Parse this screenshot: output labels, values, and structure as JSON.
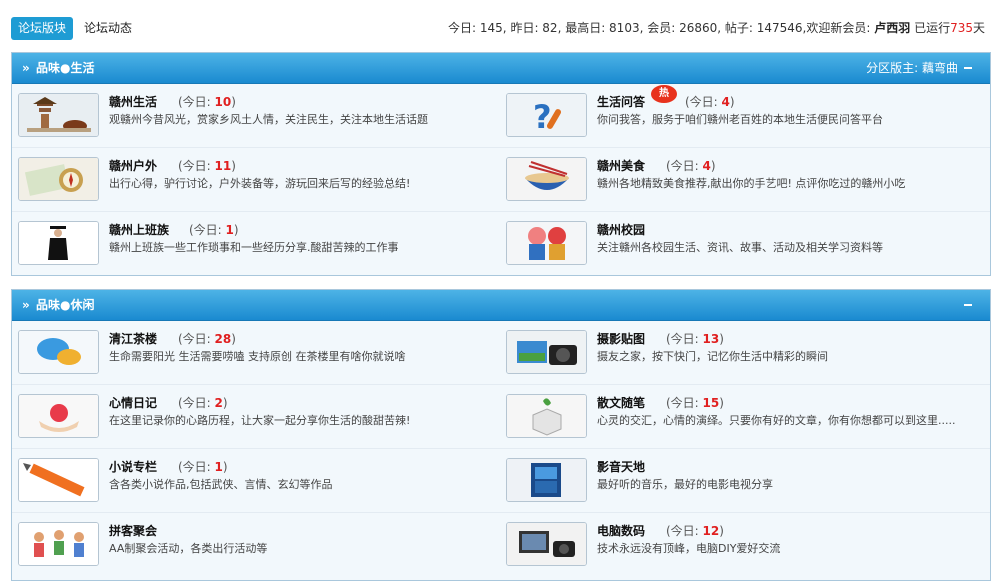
{
  "topbar": {
    "tab_active": "论坛版块",
    "tab_other": "论坛动态",
    "stats_prefix": "今日: 145, 昨日: 82, 最高日: 8103, 会员: 26860, 帖子: 147546,欢迎新会员: ",
    "new_member": "卢西羽",
    "running_prefix": "已运行",
    "running_days": "735",
    "running_suffix": "天"
  },
  "sections": [
    {
      "title": "品味●生活",
      "arrow": "»",
      "moderator_label": "分区版主: ",
      "moderator": "藕弯曲",
      "forums": [
        {
          "name": "赣州生活",
          "today_label": "(今日: ",
          "today": "10",
          "close": ")",
          "desc": "观赣州今昔风光，赏家乡风土人情，关注民生，关注本地生活话题",
          "icon": "pagoda-icon"
        },
        {
          "name": "生活问答",
          "today_label": "(今日: ",
          "today": "4",
          "close": ")",
          "desc": "你问我答，服务于咱们赣州老百姓的本地生活便民问答平台",
          "icon": "question-icon",
          "hot": "热"
        },
        {
          "name": "赣州户外",
          "today_label": "(今日: ",
          "today": "11",
          "close": ")",
          "desc": "出行心得，驴行讨论，户外装备等，游玩回来后写的经验总结!",
          "icon": "compass-map-icon"
        },
        {
          "name": "赣州美食",
          "today_label": "(今日: ",
          "today": "4",
          "close": ")",
          "desc": "赣州各地精致美食推荐,献出你的手艺吧! 点评你吃过的赣州小吃",
          "icon": "noodle-bowl-icon"
        },
        {
          "name": "赣州上班族",
          "today_label": "(今日: ",
          "today": "1",
          "close": ")",
          "desc": "赣州上班族一些工作琐事和一些经历分享.酸甜苦辣的工作事",
          "icon": "graduate-icon"
        },
        {
          "name": "赣州校园",
          "today_label": "",
          "today": "",
          "close": "",
          "desc": "关注赣州各校园生活、资讯、故事、活动及相关学习资料等",
          "icon": "dolls-icon"
        }
      ]
    },
    {
      "title": "品味●休闲",
      "arrow": "»",
      "moderator_label": "",
      "moderator": "",
      "forums": [
        {
          "name": "清江茶楼",
          "today_label": "(今日: ",
          "today": "28",
          "close": ")",
          "desc": "生命需要阳光 生活需要唠嗑 支持原创 在茶楼里有啥你就说啥",
          "icon": "chat-bubbles-icon"
        },
        {
          "name": "摄影贴图",
          "today_label": "(今日: ",
          "today": "13",
          "close": ")",
          "desc": "摄友之家，按下快门，记忆你生活中精彩的瞬间",
          "icon": "camera-icon"
        },
        {
          "name": "心情日记",
          "today_label": "(今日: ",
          "today": "2",
          "close": ")",
          "desc": "在这里记录你的心路历程，让大家一起分享你生活的酸甜苦辣!",
          "icon": "apple-hands-icon"
        },
        {
          "name": "散文随笔",
          "today_label": "(今日: ",
          "today": "15",
          "close": ")",
          "desc": "心灵的交汇，心情的演绎。只要你有好的文章，你有你想都可以到这里.....",
          "icon": "box-leaf-icon"
        },
        {
          "name": "小说专栏",
          "today_label": "(今日: ",
          "today": "1",
          "close": ")",
          "desc": "含各类小说作品,包括武侠、言情、玄幻等作品",
          "icon": "pencil-icon"
        },
        {
          "name": "影音天地",
          "today_label": "",
          "today": "",
          "close": "",
          "desc": "最好听的音乐，最好的电影电视分享",
          "icon": "film-icon"
        },
        {
          "name": "拼客聚会",
          "today_label": "",
          "today": "",
          "close": "",
          "desc": "AA制聚会活动，各类出行活动等",
          "icon": "people-icon"
        },
        {
          "name": "电脑数码",
          "today_label": "(今日: ",
          "today": "12",
          "close": ")",
          "desc": "技术永远没有顶峰，电脑DIY爱好交流",
          "icon": "computer-icon"
        }
      ]
    }
  ]
}
